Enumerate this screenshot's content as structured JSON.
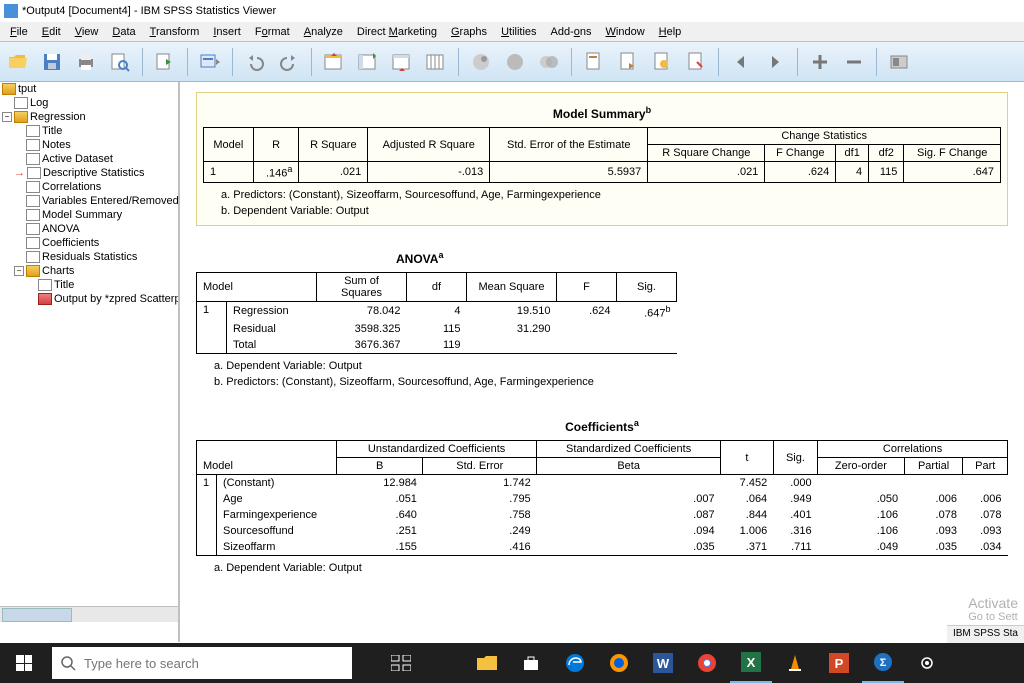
{
  "title": "*Output4 [Document4] - IBM SPSS Statistics Viewer",
  "menus": [
    "File",
    "Edit",
    "View",
    "Data",
    "Transform",
    "Insert",
    "Format",
    "Analyze",
    "Direct Marketing",
    "Graphs",
    "Utilities",
    "Add-ons",
    "Window",
    "Help"
  ],
  "nav": {
    "root": "tput",
    "items": [
      "Log",
      "Regression"
    ],
    "reg_children": [
      "Title",
      "Notes",
      "Active Dataset",
      "Descriptive Statistics",
      "Correlations",
      "Variables Entered/Removed",
      "Model Summary",
      "ANOVA",
      "Coefficients",
      "Residuals Statistics",
      "Charts"
    ],
    "charts_children": [
      "Title",
      "Output by *zpred Scatterp"
    ]
  },
  "model_summary": {
    "title": "Model Summary",
    "sup": "b",
    "headers_top": [
      "Model",
      "R",
      "R Square",
      "Adjusted R Square",
      "Std. Error of the Estimate"
    ],
    "change_group": "Change Statistics",
    "change_headers": [
      "R Square Change",
      "F Change",
      "df1",
      "df2",
      "Sig. F Change"
    ],
    "row": [
      "1",
      ".146",
      ".021",
      "-.013",
      "5.5937",
      ".021",
      ".624",
      "4",
      "115",
      ".647"
    ],
    "r_sup": "a",
    "footnote_a": "a. Predictors: (Constant), Sizeoffarm, Sourcesoffund, Age, Farmingexperience",
    "footnote_b": "b. Dependent Variable: Output"
  },
  "anova": {
    "title": "ANOVA",
    "sup": "a",
    "headers": [
      "Model",
      "",
      "Sum of Squares",
      "df",
      "Mean Square",
      "F",
      "Sig."
    ],
    "rows": [
      [
        "1",
        "Regression",
        "78.042",
        "4",
        "19.510",
        ".624",
        ".647"
      ],
      [
        "",
        "Residual",
        "3598.325",
        "115",
        "31.290",
        "",
        ""
      ],
      [
        "",
        "Total",
        "3676.367",
        "119",
        "",
        "",
        ""
      ]
    ],
    "sig_sup": "b",
    "footnote_a": "a. Dependent Variable: Output",
    "footnote_b": "b. Predictors: (Constant), Sizeoffarm, Sourcesoffund, Age, Farmingexperience"
  },
  "coef": {
    "title": "Coefficients",
    "sup": "a",
    "group_unstd": "Unstandardized Coefficients",
    "group_std": "Standardized Coefficients",
    "group_corr": "Correlations",
    "headers": [
      "Model",
      "",
      "B",
      "Std. Error",
      "Beta",
      "t",
      "Sig.",
      "Zero-order",
      "Partial",
      "Part"
    ],
    "rows": [
      [
        "1",
        "(Constant)",
        "12.984",
        "1.742",
        "",
        "7.452",
        ".000",
        "",
        "",
        ""
      ],
      [
        "",
        "Age",
        ".051",
        ".795",
        ".007",
        ".064",
        ".949",
        ".050",
        ".006",
        ".006"
      ],
      [
        "",
        "Farmingexperience",
        ".640",
        ".758",
        ".087",
        ".844",
        ".401",
        ".106",
        ".078",
        ".078"
      ],
      [
        "",
        "Sourcesoffund",
        ".251",
        ".249",
        ".094",
        "1.006",
        ".316",
        ".106",
        ".093",
        ".093"
      ],
      [
        "",
        "Sizeoffarm",
        ".155",
        ".416",
        ".035",
        ".371",
        ".711",
        ".049",
        ".035",
        ".034"
      ]
    ],
    "footnote_a": "a. Dependent Variable: Output"
  },
  "watermark": {
    "line1": "Activate",
    "line2": "Go to Sett"
  },
  "statusbar": "IBM SPSS Sta",
  "search_placeholder": "Type here to search"
}
